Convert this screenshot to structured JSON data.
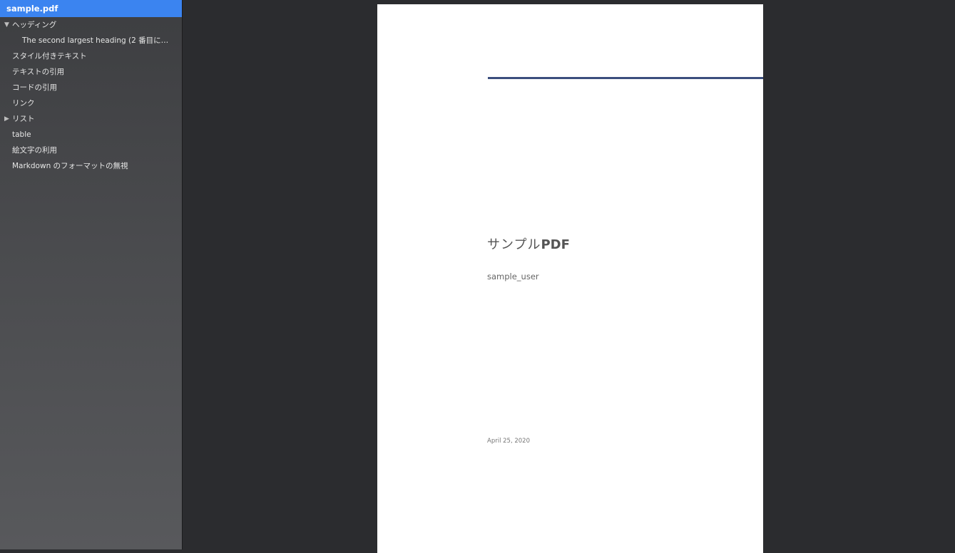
{
  "sidebar": {
    "file_name": "sample.pdf",
    "outline": [
      {
        "label": "ヘッディング",
        "disclosure": "▼"
      },
      {
        "label": "The second largest heading (2 番目に大…"
      },
      {
        "label": "スタイル付きテキスト"
      },
      {
        "label": "テキストの引用"
      },
      {
        "label": "コードの引用"
      },
      {
        "label": "リンク"
      },
      {
        "label": "リスト",
        "disclosure": "▶"
      },
      {
        "label": "table"
      },
      {
        "label": "絵文字の利用"
      },
      {
        "label": "Markdown のフォーマットの無視"
      }
    ]
  },
  "document": {
    "title_prefix": "サンプル",
    "title_suffix": "PDF",
    "author": "sample_user",
    "date": "April 25, 2020",
    "rule_color": "#3b4e7e"
  },
  "colors": {
    "selection": "#3b84f0",
    "background": "#2b2c2f"
  }
}
